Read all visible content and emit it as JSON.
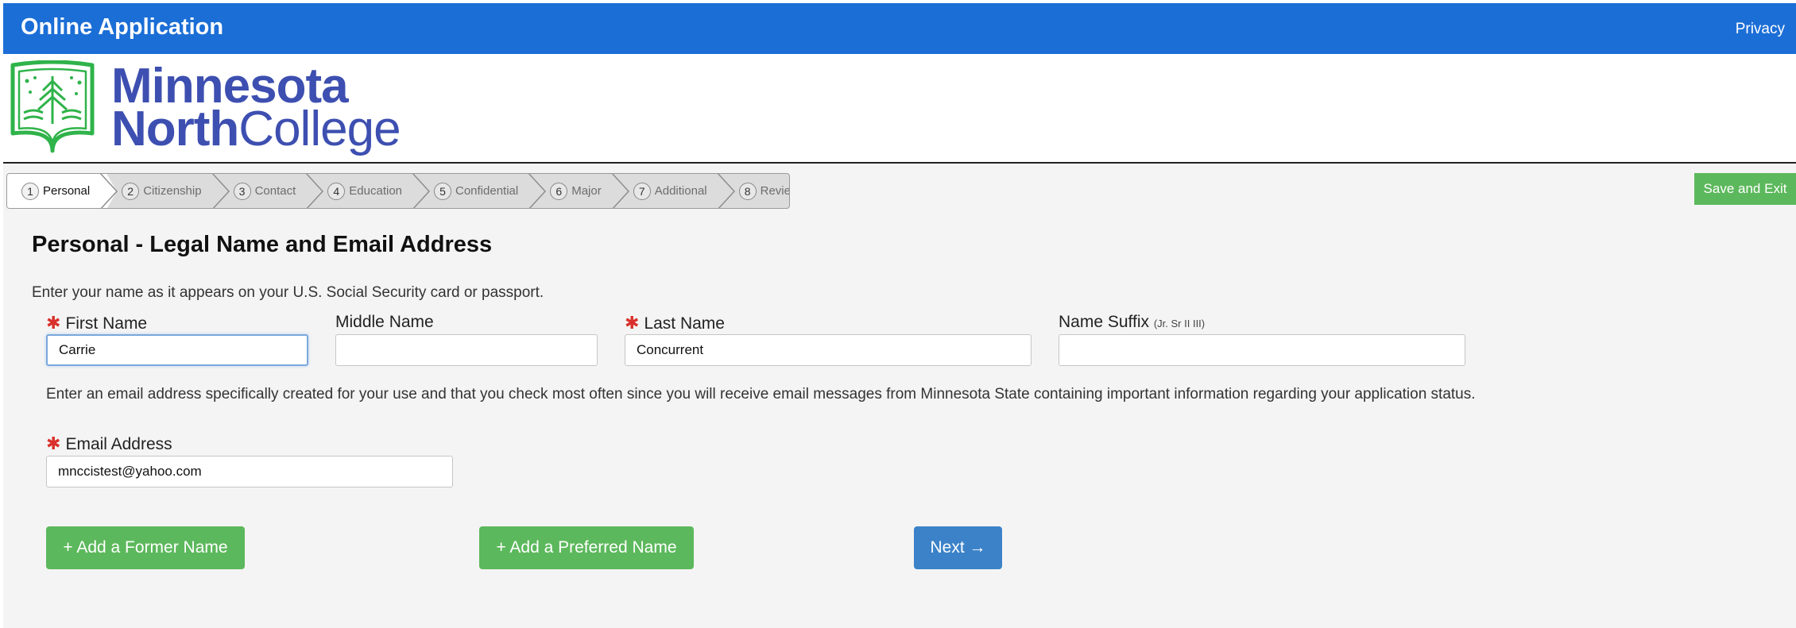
{
  "header": {
    "title": "Online Application",
    "privacy_link": "Privacy"
  },
  "brand": {
    "logo_line1": "Minnesota",
    "logo_line2_bold": "North",
    "logo_line2_rest": "College",
    "color": "#3d4fb0",
    "logo_green": "#2fb34a"
  },
  "stepper": {
    "steps": [
      {
        "num": "1",
        "label": "Personal",
        "active": true
      },
      {
        "num": "2",
        "label": "Citizenship"
      },
      {
        "num": "3",
        "label": "Contact"
      },
      {
        "num": "4",
        "label": "Education"
      },
      {
        "num": "5",
        "label": "Confidential"
      },
      {
        "num": "6",
        "label": "Major"
      },
      {
        "num": "7",
        "label": "Additional"
      },
      {
        "num": "8",
        "label": "Review"
      }
    ]
  },
  "actions": {
    "save_exit": "Save and Exit"
  },
  "form": {
    "section_title": "Personal - Legal Name and Email Address",
    "instruction": "Enter your name as it appears on your U.S. Social Security card or passport.",
    "required_marker": "✱",
    "first_name": {
      "label": "First Name",
      "value": "Carrie"
    },
    "middle_name": {
      "label": "Middle Name",
      "value": ""
    },
    "last_name": {
      "label": "Last Name",
      "value": "Concurrent"
    },
    "name_suffix": {
      "label": "Name Suffix",
      "hint": "(Jr. Sr II III)",
      "value": ""
    },
    "email_note": "Enter an email address specifically created for your use and that you check most often since you will receive email messages from Minnesota State containing important information regarding your application status.",
    "email": {
      "label": "Email Address",
      "value": "mnccistest@yahoo.com"
    }
  },
  "buttons": {
    "add_former_name": "+ Add a Former Name",
    "add_preferred_name": "+ Add a Preferred Name",
    "next": "Next →"
  },
  "colors": {
    "header_blue": "#1b6ed6",
    "button_green": "#5cb85c",
    "button_blue": "#3b82c8",
    "required_red": "#d9302b"
  }
}
